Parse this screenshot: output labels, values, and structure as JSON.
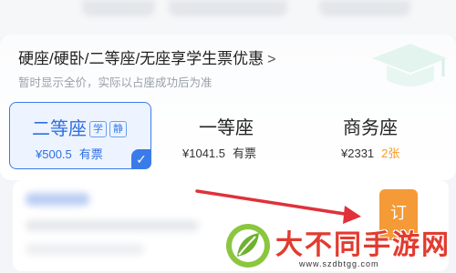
{
  "promo": {
    "title": "硬座/硬卧/二等座/无座享学生票优惠",
    "chevron": ">",
    "subtitle": "暂时显示全价，实际以占座成功后为准"
  },
  "seats": [
    {
      "name": "二等座",
      "tags": [
        "学",
        "静"
      ],
      "price": "¥500.5",
      "availability": "有票",
      "selected": true
    },
    {
      "name": "一等座",
      "price": "¥1041.5",
      "availability": "有票",
      "selected": false
    },
    {
      "name": "商务座",
      "price": "¥2331",
      "availability": "2张",
      "selected": false
    }
  ],
  "book_button": {
    "label": "订"
  },
  "watermark": {
    "title": "大不同手游网",
    "url": "www.szdbtgg.com"
  },
  "colors": {
    "accent": "#3a7bea",
    "orange": "#f49a37",
    "arrow": "#e0313a"
  }
}
